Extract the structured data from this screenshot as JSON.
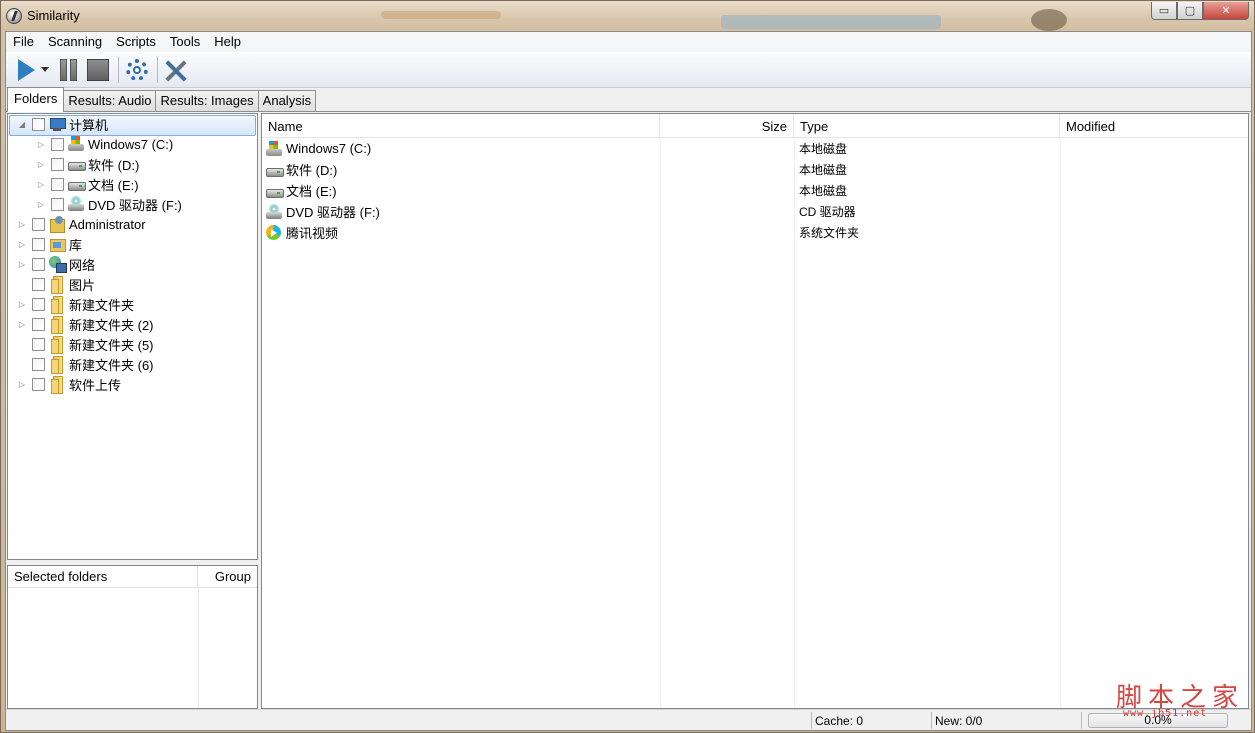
{
  "window": {
    "title": "Similarity",
    "buttons": {
      "minimize": "▭",
      "maximize": "▢",
      "close": "✕"
    }
  },
  "menu": [
    "File",
    "Scanning",
    "Scripts",
    "Tools",
    "Help"
  ],
  "toolbar": {
    "items": [
      "play-icon",
      "dropdown-icon",
      "pause-icon",
      "stop-icon",
      "settings-icon",
      "tools-icon"
    ]
  },
  "tabs": [
    {
      "label": "Folders",
      "active": true
    },
    {
      "label": "Results: Audio"
    },
    {
      "label": "Results: Images"
    },
    {
      "label": "Analysis"
    }
  ],
  "tree": [
    {
      "label": "计算机",
      "level": 0,
      "expand": "◢",
      "icon": "computer-icon",
      "selected": true
    },
    {
      "label": "Windows7 (C:)",
      "level": 1,
      "expand": "▷",
      "icon": "windows-drive-icon"
    },
    {
      "label": "软件 (D:)",
      "level": 1,
      "expand": "▷",
      "icon": "drive-icon"
    },
    {
      "label": "文档 (E:)",
      "level": 1,
      "expand": "▷",
      "icon": "drive-icon"
    },
    {
      "label": "DVD 驱动器 (F:)",
      "level": 1,
      "expand": "▷",
      "icon": "dvd-drive-icon"
    },
    {
      "label": "Administrator",
      "level": 0,
      "expand": "▷",
      "icon": "user-folder-icon"
    },
    {
      "label": "库",
      "level": 0,
      "expand": "▷",
      "icon": "library-icon"
    },
    {
      "label": "网络",
      "level": 0,
      "expand": "▷",
      "icon": "network-icon"
    },
    {
      "label": "图片",
      "level": 0,
      "expand": "",
      "icon": "folder-icon"
    },
    {
      "label": "新建文件夹",
      "level": 0,
      "expand": "▷",
      "icon": "folder-icon"
    },
    {
      "label": "新建文件夹 (2)",
      "level": 0,
      "expand": "▷",
      "icon": "folder-icon"
    },
    {
      "label": "新建文件夹 (5)",
      "level": 0,
      "expand": "",
      "icon": "folder-icon"
    },
    {
      "label": "新建文件夹 (6)",
      "level": 0,
      "expand": "",
      "icon": "folder-icon"
    },
    {
      "label": "软件上传",
      "level": 0,
      "expand": "▷",
      "icon": "folder-icon"
    }
  ],
  "selected_folders": {
    "col_name": "Selected folders",
    "col_group": "Group"
  },
  "list": {
    "columns": {
      "name": "Name",
      "size": "Size",
      "type": "Type",
      "modified": "Modified"
    },
    "rows": [
      {
        "name": "Windows7 (C:)",
        "size": "",
        "type": "本地磁盘",
        "modified": "",
        "icon": "windows-drive-icon"
      },
      {
        "name": "软件 (D:)",
        "size": "",
        "type": "本地磁盘",
        "modified": "",
        "icon": "drive-icon"
      },
      {
        "name": "文档 (E:)",
        "size": "",
        "type": "本地磁盘",
        "modified": "",
        "icon": "drive-icon"
      },
      {
        "name": "DVD 驱动器 (F:)",
        "size": "",
        "type": "CD 驱动器",
        "modified": "",
        "icon": "dvd-drive-icon"
      },
      {
        "name": "腾讯视频",
        "size": "",
        "type": "系统文件夹",
        "modified": "",
        "icon": "tencent-video-icon"
      }
    ]
  },
  "status": {
    "cache": "Cache: 0",
    "new": "New: 0/0",
    "progress_text": "0.0%",
    "progress_value": 0.0
  },
  "watermark": {
    "text": "脚本之家",
    "sub": "www.jb51.net"
  },
  "colors": {
    "accent": "#2f7fc0",
    "selection_border": "#84acdd",
    "watermark": "#d2322d"
  }
}
